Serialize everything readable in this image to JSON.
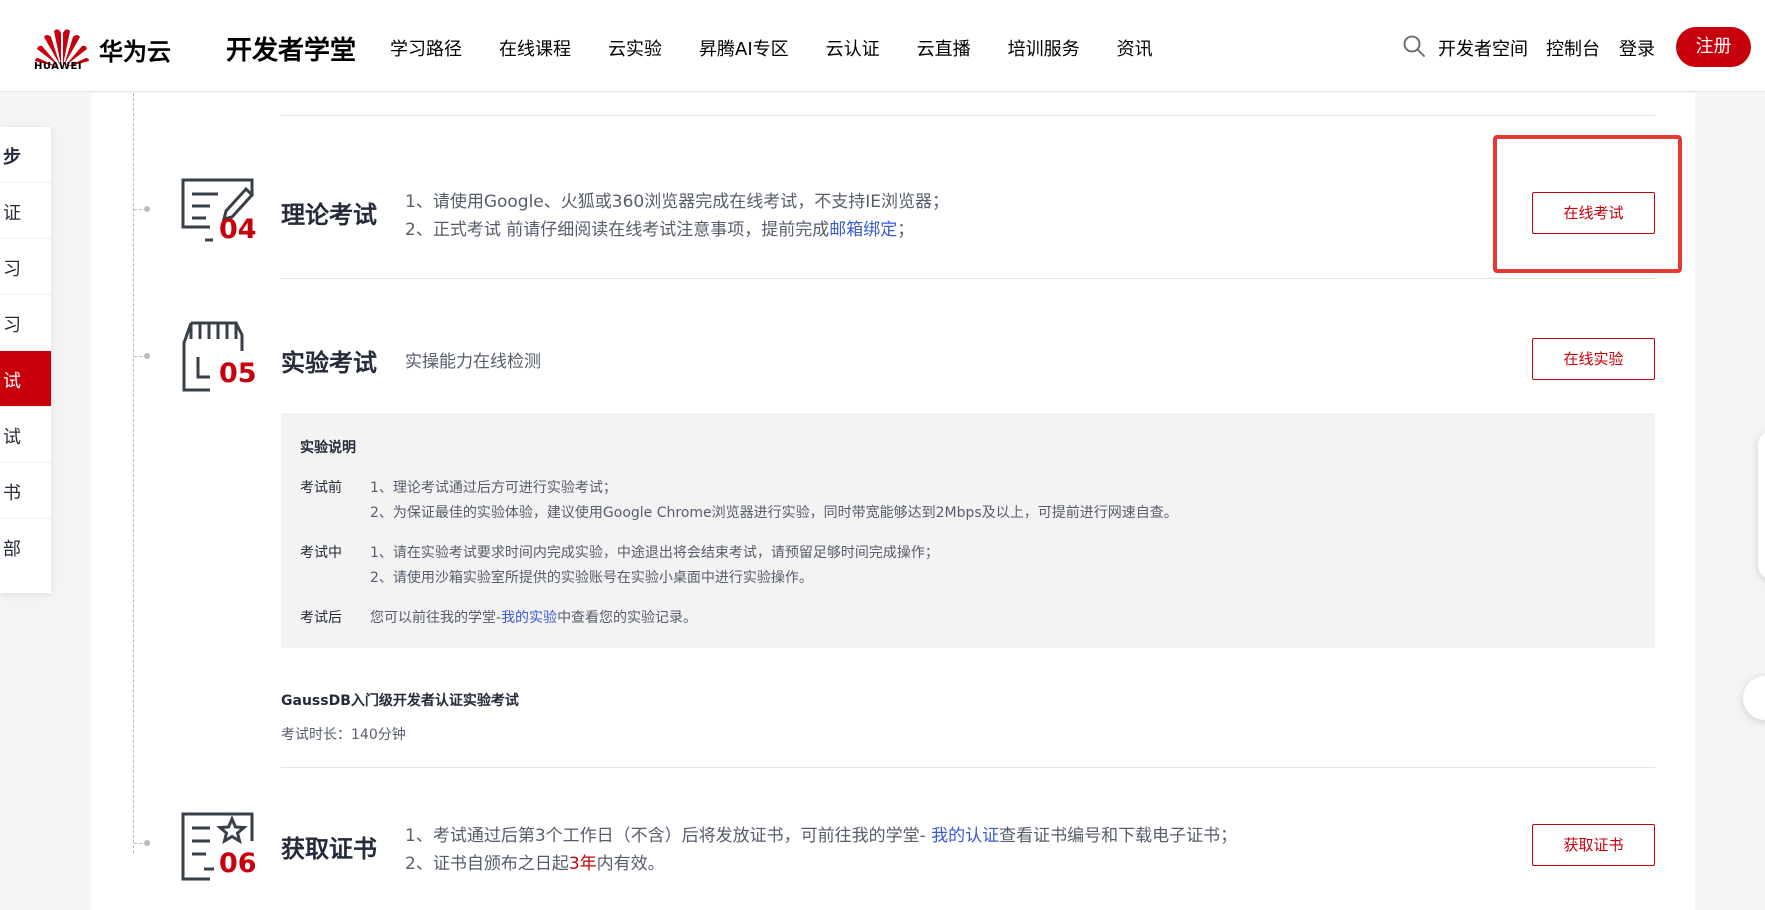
{
  "header": {
    "logo_word": "HUAWEI",
    "brand": "华为云",
    "site_title": "开发者学堂",
    "nav": [
      "学习路径",
      "在线课程",
      "云实验",
      "昇腾AI专区",
      "云认证",
      "云直播",
      "培训服务",
      "资讯"
    ],
    "developer_space": "开发者空间",
    "console": "控制台",
    "login": "登录",
    "register": "注册"
  },
  "stepnav": {
    "items": [
      "步",
      "证",
      "习",
      "习",
      "试",
      "试",
      "书",
      "部"
    ],
    "active_index": 4
  },
  "steps": {
    "theory": {
      "num": "04",
      "title": "理论考试",
      "line1": "1、请使用Google、火狐或360浏览器完成在线考试，不支持IE浏览器；",
      "line2_pre": "2、正式考试 前请仔细阅读在线考试注意事项，提前完成",
      "line2_link": "邮箱绑定",
      "line2_post": "；",
      "button": "在线考试"
    },
    "lab": {
      "num": "05",
      "title": "实验考试",
      "subtitle": "实操能力在线检测",
      "button": "在线实验",
      "info": {
        "title": "实验说明",
        "before_label": "考试前",
        "before_1": "1、理论考试通过后方可进行实验考试；",
        "before_2": "2、为保证最佳的实验体验，建议使用Google Chrome浏览器进行实验，同时带宽能够达到2Mbps及以上，可提前进行网速自查。",
        "during_label": "考试中",
        "during_1": "1、请在实验考试要求时间内完成实验，中途退出将会结束考试，请预留足够时间完成操作；",
        "during_2": "2、请使用沙箱实验室所提供的实验账号在实验小桌面中进行实验操作。",
        "after_label": "考试后",
        "after_pre": "您可以前往我的学堂-",
        "after_link": "我的实验",
        "after_post": "中查看您的实验记录。"
      },
      "exam_name": "GaussDB入门级开发者认证实验考试",
      "exam_duration": "考试时长：140分钟"
    },
    "cert": {
      "num": "06",
      "title": "获取证书",
      "line1_pre": "1、考试通过后第3个工作日（不含）后将发放证书，可前往我的学堂- ",
      "line1_link": "我的认证",
      "line1_post": "查看证书编号和下载电子证书；",
      "line2_pre": "2、证书自颁布之日起",
      "line2_red": "3年",
      "line2_post": "内有效。",
      "button": "获取证书"
    }
  },
  "colors": {
    "brand_red": "#c7000b",
    "link_blue": "#3b5ad6",
    "highlight_red": "#e53935"
  }
}
